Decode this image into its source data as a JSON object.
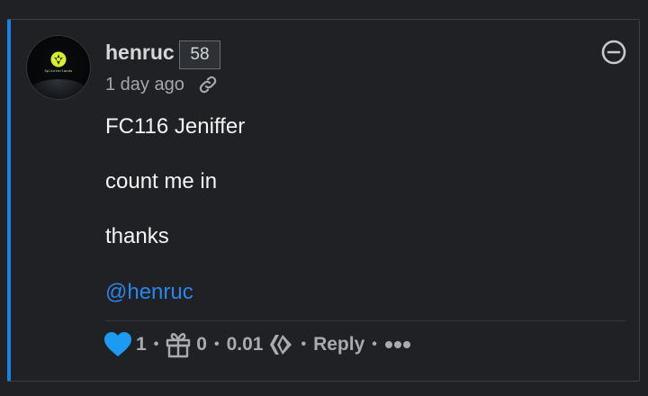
{
  "comment": {
    "author": "henruc",
    "reputation": "58",
    "timestamp": "1 day ago",
    "body_lines": [
      "FC116 Jeniffer",
      "count me in",
      "thanks"
    ],
    "mention": "@henruc"
  },
  "avatar": {
    "brand_text": "Splinterlands"
  },
  "footer": {
    "votes": "1",
    "gifts": "0",
    "payout": "0.01",
    "reply_label": "Reply",
    "separator": "•"
  },
  "icons": {
    "vote": "heart-icon",
    "gift": "gift-icon",
    "payout": "hive-icon",
    "link": "link-icon",
    "collapse": "minus-circle-icon",
    "more": "more-icon"
  },
  "colors": {
    "background": "#1f2124",
    "accent_border": "#1d7ee4",
    "mention": "#2a86e8",
    "heart": "#1d9bf0",
    "text": "#f3f4f5",
    "muted": "#a8abaf"
  }
}
